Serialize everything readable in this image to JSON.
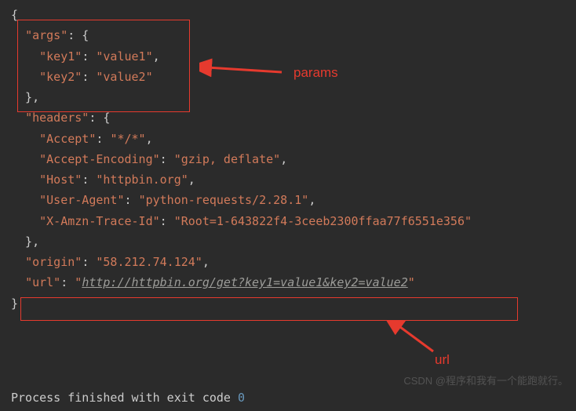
{
  "json": {
    "open_brace": "{",
    "args_key": "\"args\"",
    "args_open": ": {",
    "key1_key": "\"key1\"",
    "key1_val": "\"value1\"",
    "key2_key": "\"key2\"",
    "key2_val": "\"value2\"",
    "args_close": "  },",
    "headers_key": "\"headers\"",
    "headers_open": ": {",
    "accept_key": "\"Accept\"",
    "accept_val": "\"*/*\"",
    "enc_key": "\"Accept-Encoding\"",
    "enc_val": "\"gzip, deflate\"",
    "host_key": "\"Host\"",
    "host_val": "\"httpbin.org\"",
    "ua_key": "\"User-Agent\"",
    "ua_val": "\"python-requests/2.28.1\"",
    "trace_key": "\"X-Amzn-Trace-Id\"",
    "trace_val": "\"Root=1-643822f4-3ceeb2300ffaa77f6551e356\"",
    "headers_close": "  },",
    "origin_key": "\"origin\"",
    "origin_val": "\"58.212.74.124\"",
    "url_key": "\"url\"",
    "url_q1": "\"",
    "url_link": "http://httpbin.org/get?key1=value1&key2=value2",
    "url_q2": "\"",
    "close_brace": "}"
  },
  "labels": {
    "params": "params",
    "url": "url"
  },
  "footer": {
    "text_pre": "Process finished with exit code ",
    "code": "0"
  },
  "watermark": "CSDN @程序和我有一个能跑就行。"
}
